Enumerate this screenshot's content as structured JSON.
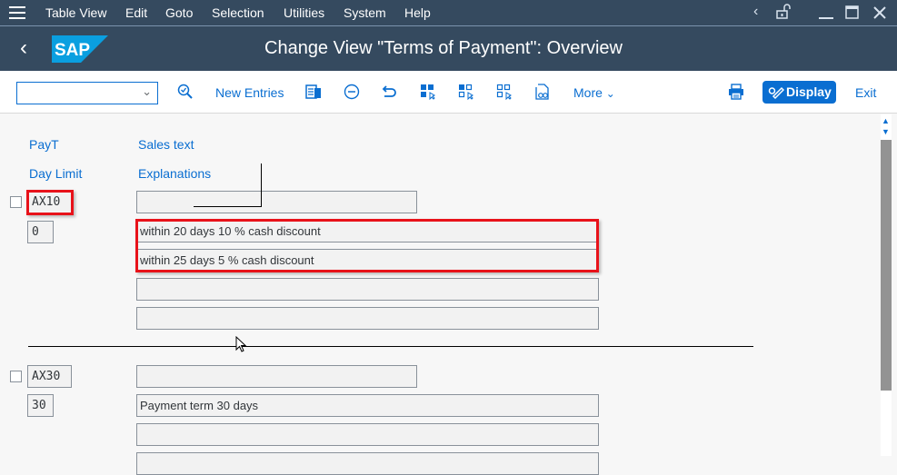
{
  "menubar": {
    "items": [
      "Table View",
      "Edit",
      "Goto",
      "Selection",
      "Utilities",
      "System",
      "Help"
    ]
  },
  "title": "Change View \"Terms of Payment\": Overview",
  "toolbar": {
    "command_field": {
      "value": "",
      "placeholder": ""
    },
    "new_entries": "New Entries",
    "more": "More",
    "display": "Display",
    "exit": "Exit"
  },
  "columns": {
    "payt": "PayT",
    "sales_text": "Sales text",
    "day_limit": "Day Limit",
    "explanations": "Explanations"
  },
  "entries": [
    {
      "payt": "AX10",
      "sales_text": "",
      "day_limit": "0",
      "explanations": [
        "within 20 days 10 % cash discount",
        "within 25 days 5 % cash discount",
        "",
        ""
      ]
    },
    {
      "payt": "AX30",
      "sales_text": "",
      "day_limit": "30",
      "explanations": [
        "Payment term 30 days",
        "",
        ""
      ]
    }
  ],
  "colors": {
    "shell": "#354a5f",
    "accent": "#0a6ed1",
    "highlight": "#e8121a"
  }
}
